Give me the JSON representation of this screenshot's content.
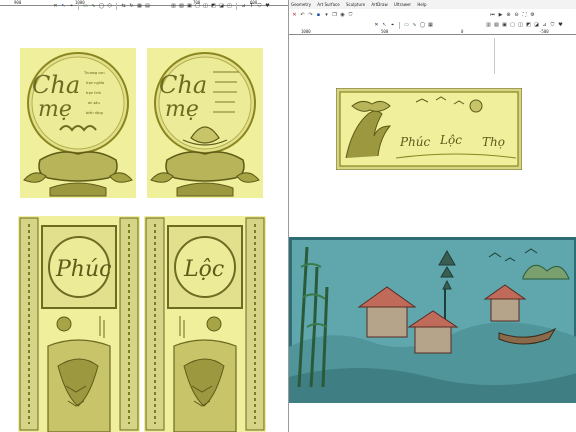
{
  "left_ruler": {
    "labels": [
      "900",
      "1000",
      "700",
      "600"
    ]
  },
  "right_window": {
    "menu": [
      "Geometry",
      "Art Surface",
      "Sculpture",
      "ArtDraw",
      "Ultrawer",
      "Help"
    ],
    "ruler_labels": [
      "1000",
      "500",
      "0",
      "-500"
    ]
  },
  "reliefs": {
    "parent_panel_1": {
      "big_text": "Cha",
      "big_text_2": "mẹ",
      "small_lines": [
        "Thương con",
        "trọn nghĩa",
        "trọn tình",
        "ơn sâu",
        "biển rộng"
      ]
    },
    "parent_panel_2": {
      "big_text": "Cha",
      "big_text_2": "mẹ"
    },
    "landscape_panel": {
      "text_a": "Phúc",
      "text_b": "Lộc",
      "text_c": "Thọ"
    },
    "door_panel_left": {
      "word": "Phúc"
    },
    "door_panel_right": {
      "word": "Lộc"
    }
  },
  "colors": {
    "relief_gold": "#d6d486",
    "relief_dark": "#6d6a22",
    "relief_bg": "#efef9c",
    "teal_bg": "#5fa7ad",
    "teal_dark": "#2f6d74"
  }
}
